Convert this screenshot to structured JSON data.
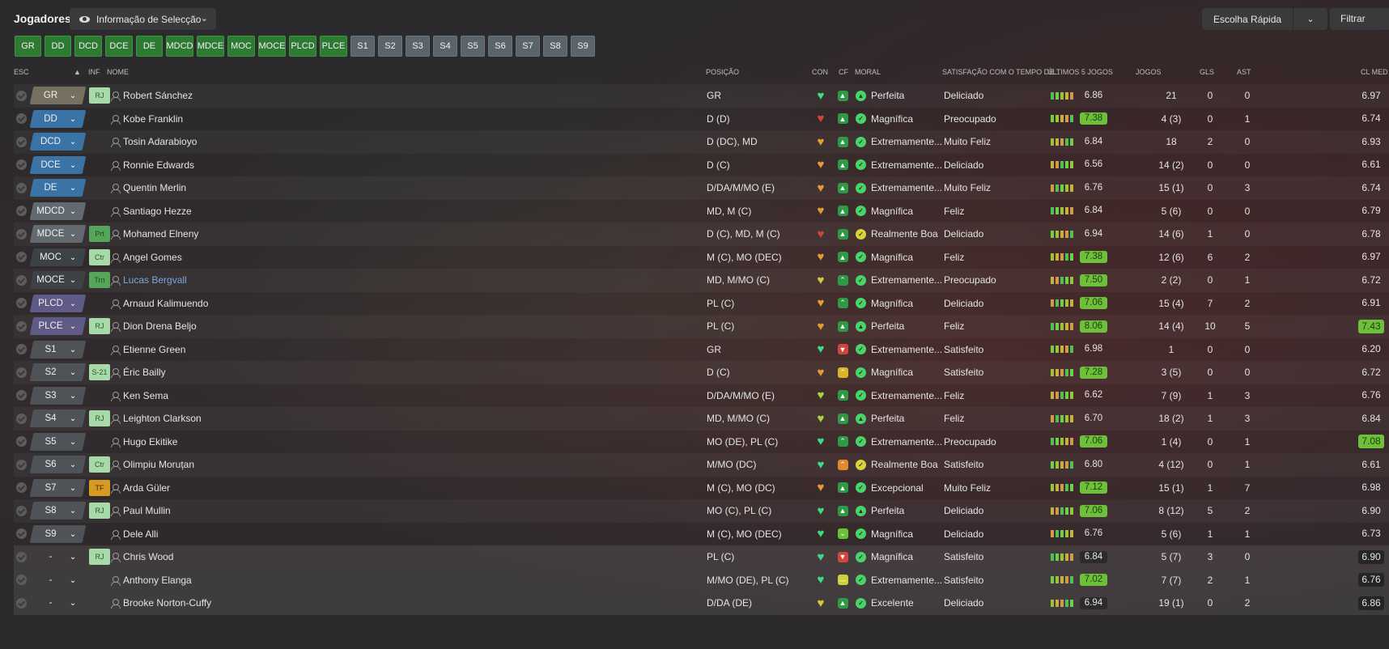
{
  "topbar": {
    "title": "Jogadores",
    "view_label": "Informação de Selecção",
    "quick_pick": "Escolha Rápida",
    "filter": "Filtrar"
  },
  "positions": [
    {
      "label": "GR",
      "kind": "g"
    },
    {
      "label": "DD",
      "kind": "g"
    },
    {
      "label": "DCD",
      "kind": "g"
    },
    {
      "label": "DCE",
      "kind": "g"
    },
    {
      "label": "DE",
      "kind": "g"
    },
    {
      "label": "MDCD",
      "kind": "g"
    },
    {
      "label": "MDCE",
      "kind": "g"
    },
    {
      "label": "MOC",
      "kind": "g"
    },
    {
      "label": "MOCE",
      "kind": "g"
    },
    {
      "label": "PLCD",
      "kind": "g"
    },
    {
      "label": "PLCE",
      "kind": "g"
    },
    {
      "label": "S1",
      "kind": "s"
    },
    {
      "label": "S2",
      "kind": "s"
    },
    {
      "label": "S3",
      "kind": "s"
    },
    {
      "label": "S4",
      "kind": "s"
    },
    {
      "label": "S5",
      "kind": "s"
    },
    {
      "label": "S6",
      "kind": "s"
    },
    {
      "label": "S7",
      "kind": "s"
    },
    {
      "label": "S8",
      "kind": "s"
    },
    {
      "label": "S9",
      "kind": "s"
    }
  ],
  "columns": {
    "esc": "ESC",
    "inf": "INF",
    "nome": "NOME",
    "posicao": "POSIÇÃO",
    "con": "CON",
    "cf": "CF",
    "moral": "MORAL",
    "satisfacao": "SATISFAÇÃO COM O TEMPO DE...",
    "ultimos": "ÚLTIMOS 5 JOGOS",
    "jogos": "JOGOS",
    "gls": "GLS",
    "ast": "AST",
    "clmed": "CL MED"
  },
  "colors": {
    "green_button": "#2f7a33",
    "sub_button": "#5b646b",
    "rating_high": "#6ec03a",
    "heart_green": "#3ddc84",
    "heart_orange": "#e79a3a",
    "heart_yellow": "#d9c83a",
    "heart_red": "#d0463b"
  },
  "players": [
    {
      "sel": "GR",
      "selk": "gk",
      "inf": "RJ",
      "infk": "rj",
      "name": "Robert Sánchez",
      "pos": "GR",
      "con": "green",
      "cf": "green",
      "mi": "up",
      "moral": "Perfeita",
      "sat": "Deliciado",
      "rating": "6.86",
      "rk": "",
      "jogos": "21",
      "gls": "0",
      "ast": "0",
      "clmed": "6.97",
      "ck": ""
    },
    {
      "sel": "DD",
      "selk": "df",
      "inf": "",
      "infk": "",
      "name": "Kobe Franklin",
      "pos": "D (D)",
      "con": "red",
      "cf": "green",
      "mi": "check",
      "moral": "Magnífica",
      "sat": "Preocupado",
      "rating": "7.38",
      "rk": "hi",
      "jogos": "4 (3)",
      "gls": "0",
      "ast": "1",
      "clmed": "6.74",
      "ck": ""
    },
    {
      "sel": "DCD",
      "selk": "df",
      "inf": "",
      "infk": "",
      "name": "Tosin Adarabioyo",
      "pos": "D (DC), MD",
      "con": "orange",
      "cf": "green",
      "mi": "check",
      "moral": "Extremamente...",
      "sat": "Muito Feliz",
      "rating": "6.84",
      "rk": "",
      "jogos": "18",
      "gls": "2",
      "ast": "0",
      "clmed": "6.93",
      "ck": ""
    },
    {
      "sel": "DCE",
      "selk": "df",
      "inf": "",
      "infk": "",
      "name": "Ronnie Edwards",
      "pos": "D (C)",
      "con": "orange",
      "cf": "green",
      "mi": "check",
      "moral": "Extremamente...",
      "sat": "Deliciado",
      "rating": "6.56",
      "rk": "",
      "jogos": "14 (2)",
      "gls": "0",
      "ast": "0",
      "clmed": "6.61",
      "ck": ""
    },
    {
      "sel": "DE",
      "selk": "df",
      "inf": "",
      "infk": "",
      "name": "Quentin Merlin",
      "pos": "D/DA/M/MO (E)",
      "con": "orange",
      "cf": "green",
      "mi": "check",
      "moral": "Extremamente...",
      "sat": "Muito Feliz",
      "rating": "6.76",
      "rk": "",
      "jogos": "15 (1)",
      "gls": "0",
      "ast": "3",
      "clmed": "6.74",
      "ck": ""
    },
    {
      "sel": "MDCD",
      "selk": "dm",
      "inf": "",
      "infk": "",
      "name": "Santiago Hezze",
      "pos": "MD, M (C)",
      "con": "orange",
      "cf": "green",
      "mi": "check",
      "moral": "Magnífica",
      "sat": "Feliz",
      "rating": "6.84",
      "rk": "",
      "jogos": "5 (6)",
      "gls": "0",
      "ast": "0",
      "clmed": "6.79",
      "ck": ""
    },
    {
      "sel": "MDCE",
      "selk": "dm",
      "inf": "Prt",
      "infk": "prt",
      "name": "Mohamed Elneny",
      "pos": "D (C), MD, M (C)",
      "con": "red",
      "cf": "green",
      "mi": "check",
      "moral": "Realmente Boa",
      "sat": "Deliciado",
      "rating": "6.94",
      "rk": "",
      "jogos": "14 (6)",
      "gls": "1",
      "ast": "0",
      "clmed": "6.78",
      "ck": ""
    },
    {
      "sel": "MOC",
      "selk": "mf",
      "inf": "Ctr",
      "infk": "rj",
      "name": "Angel Gomes",
      "pos": "M (C), MO (DEC)",
      "con": "orange",
      "cf": "green",
      "mi": "check",
      "moral": "Magnífica",
      "sat": "Feliz",
      "rating": "7.38",
      "rk": "hi",
      "jogos": "12 (6)",
      "gls": "6",
      "ast": "2",
      "clmed": "6.97",
      "ck": ""
    },
    {
      "sel": "MOCE",
      "selk": "mf",
      "inf": "Trn",
      "infk": "prt",
      "name": "Lucas Bergvall",
      "pos": "MD, M/MO (C)",
      "con": "yellow",
      "cf": "up",
      "mi": "check",
      "moral": "Extremamente...",
      "sat": "Preocupado",
      "rating": "7.50",
      "rk": "hi",
      "jogos": "2 (2)",
      "gls": "0",
      "ast": "1",
      "clmed": "6.72",
      "ck": "",
      "blue": true
    },
    {
      "sel": "PLCD",
      "selk": "st",
      "inf": "",
      "infk": "",
      "name": "Arnaud Kalimuendo",
      "pos": "PL (C)",
      "con": "orange",
      "cf": "up",
      "mi": "check",
      "moral": "Magnífica",
      "sat": "Deliciado",
      "rating": "7.06",
      "rk": "hi",
      "jogos": "15 (4)",
      "gls": "7",
      "ast": "2",
      "clmed": "6.91",
      "ck": ""
    },
    {
      "sel": "PLCE",
      "selk": "st",
      "inf": "RJ",
      "infk": "rj",
      "name": "Dion Drena Beljo",
      "pos": "PL (C)",
      "con": "orange",
      "cf": "green",
      "mi": "up",
      "moral": "Perfeita",
      "sat": "Feliz",
      "rating": "8.06",
      "rk": "hi",
      "jogos": "14 (4)",
      "gls": "10",
      "ast": "5",
      "clmed": "7.43",
      "ck": "hi"
    },
    {
      "sel": "S1",
      "selk": "su",
      "inf": "",
      "infk": "",
      "name": "Etienne Green",
      "pos": "GR",
      "con": "green",
      "cf": "red",
      "mi": "check",
      "moral": "Extremamente...",
      "sat": "Satisfeito",
      "rating": "6.98",
      "rk": "",
      "jogos": "1",
      "gls": "0",
      "ast": "0",
      "clmed": "6.20",
      "ck": ""
    },
    {
      "sel": "S2",
      "selk": "su",
      "inf": "S-21",
      "infk": "rj",
      "name": "Éric Bailly",
      "pos": "D (C)",
      "con": "orange",
      "cf": "yup",
      "mi": "check",
      "moral": "Magnífica",
      "sat": "Satisfeito",
      "rating": "7.28",
      "rk": "hi",
      "jogos": "3 (5)",
      "gls": "0",
      "ast": "0",
      "clmed": "6.72",
      "ck": ""
    },
    {
      "sel": "S3",
      "selk": "su",
      "inf": "",
      "infk": "",
      "name": "Ken Sema",
      "pos": "D/DA/M/MO (E)",
      "con": "yellowgreen",
      "cf": "green",
      "mi": "check",
      "moral": "Extremamente...",
      "sat": "Feliz",
      "rating": "6.62",
      "rk": "",
      "jogos": "7 (9)",
      "gls": "1",
      "ast": "3",
      "clmed": "6.76",
      "ck": ""
    },
    {
      "sel": "S4",
      "selk": "su",
      "inf": "RJ",
      "infk": "rj",
      "name": "Leighton Clarkson",
      "pos": "MD, M/MO (C)",
      "con": "yellowgreen",
      "cf": "green",
      "mi": "up",
      "moral": "Perfeita",
      "sat": "Feliz",
      "rating": "6.70",
      "rk": "",
      "jogos": "18 (2)",
      "gls": "1",
      "ast": "3",
      "clmed": "6.84",
      "ck": ""
    },
    {
      "sel": "S5",
      "selk": "su",
      "inf": "",
      "infk": "",
      "name": "Hugo Ekitike",
      "pos": "MO (DE), PL (C)",
      "con": "green",
      "cf": "up",
      "mi": "check",
      "moral": "Extremamente...",
      "sat": "Preocupado",
      "rating": "7.06",
      "rk": "hi",
      "jogos": "1 (4)",
      "gls": "0",
      "ast": "1",
      "clmed": "7.08",
      "ck": "hi"
    },
    {
      "sel": "S6",
      "selk": "su",
      "inf": "Ctr",
      "infk": "rj",
      "name": "Olimpiu Moruțan",
      "pos": "M/MO (DC)",
      "con": "green",
      "cf": "oup",
      "mi": "check",
      "moral": "Realmente Boa",
      "sat": "Satisfeito",
      "rating": "6.80",
      "rk": "",
      "jogos": "4 (12)",
      "gls": "0",
      "ast": "1",
      "clmed": "6.61",
      "ck": ""
    },
    {
      "sel": "S7",
      "selk": "su",
      "inf": "TF",
      "infk": "tf",
      "name": "Arda Güler",
      "pos": "M (C), MO (DC)",
      "con": "orange",
      "cf": "green",
      "mi": "check",
      "moral": "Excepcional",
      "sat": "Muito Feliz",
      "rating": "7.12",
      "rk": "hi",
      "jogos": "15 (1)",
      "gls": "1",
      "ast": "7",
      "clmed": "6.98",
      "ck": ""
    },
    {
      "sel": "S8",
      "selk": "su",
      "inf": "RJ",
      "infk": "rj",
      "name": "Paul Mullin",
      "pos": "MO (C), PL (C)",
      "con": "green",
      "cf": "green",
      "mi": "up",
      "moral": "Perfeita",
      "sat": "Deliciado",
      "rating": "7.06",
      "rk": "hi",
      "jogos": "8 (12)",
      "gls": "5",
      "ast": "2",
      "clmed": "6.90",
      "ck": ""
    },
    {
      "sel": "S9",
      "selk": "su",
      "inf": "",
      "infk": "",
      "name": "Dele Alli",
      "pos": "M (C), MO (DEC)",
      "con": "green",
      "cf": "gdown",
      "mi": "check",
      "moral": "Magnífica",
      "sat": "Deliciado",
      "rating": "6.76",
      "rk": "",
      "jogos": "5 (6)",
      "gls": "1",
      "ast": "1",
      "clmed": "6.73",
      "ck": ""
    },
    {
      "sel": "-",
      "selk": "no",
      "inf": "RJ",
      "infk": "rj",
      "name": "Chris Wood",
      "pos": "PL (C)",
      "con": "green",
      "cf": "red",
      "mi": "check",
      "moral": "Magnífica",
      "sat": "Satisfeito",
      "rating": "6.84",
      "rk": "dk",
      "jogos": "5 (7)",
      "gls": "3",
      "ast": "0",
      "clmed": "6.90",
      "ck": "dk",
      "hl": true
    },
    {
      "sel": "-",
      "selk": "no",
      "inf": "",
      "infk": "",
      "name": "Anthony Elanga",
      "pos": "M/MO (DE), PL (C)",
      "con": "green",
      "cf": "ymid",
      "mi": "check",
      "moral": "Extremamente...",
      "sat": "Satisfeito",
      "rating": "7.02",
      "rk": "hi",
      "jogos": "7 (7)",
      "gls": "2",
      "ast": "1",
      "clmed": "6.76",
      "ck": "dk",
      "hl": true
    },
    {
      "sel": "-",
      "selk": "no",
      "inf": "",
      "infk": "",
      "name": "Brooke Norton-Cuffy",
      "pos": "D/DA (DE)",
      "con": "yellow",
      "cf": "green",
      "mi": "check",
      "moral": "Excelente",
      "sat": "Deliciado",
      "rating": "6.94",
      "rk": "dk",
      "jogos": "19 (1)",
      "gls": "0",
      "ast": "2",
      "clmed": "6.86",
      "ck": "dk",
      "hl": true
    }
  ]
}
